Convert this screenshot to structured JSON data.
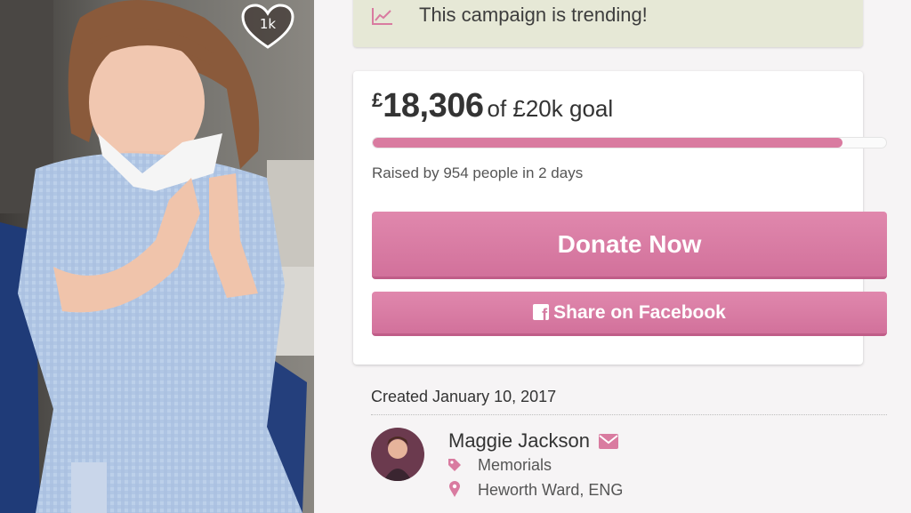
{
  "photo": {
    "alt": "campaign photo",
    "likes": "1k"
  },
  "trending": {
    "text": "This campaign is trending!"
  },
  "funding": {
    "currency_symbol": "£",
    "raised": "18,306",
    "goal_text": "of £20k goal",
    "progress_fraction": 0.915,
    "raised_by": "Raised by 954 people in 2 days"
  },
  "buttons": {
    "donate": "Donate Now",
    "share": "Share on Facebook"
  },
  "meta": {
    "created": "Created January 10, 2017",
    "owner_name": "Maggie Jackson",
    "category": "Memorials",
    "location": "Heworth Ward, ENG"
  },
  "colors": {
    "accent": "#d97ba0",
    "trend_bg": "#e6e8d6",
    "page_bg": "#f6f4f5"
  },
  "icons": [
    "heart-icon",
    "trend-chart-icon",
    "facebook-icon",
    "mail-icon",
    "tag-icon",
    "map-pin-icon"
  ]
}
